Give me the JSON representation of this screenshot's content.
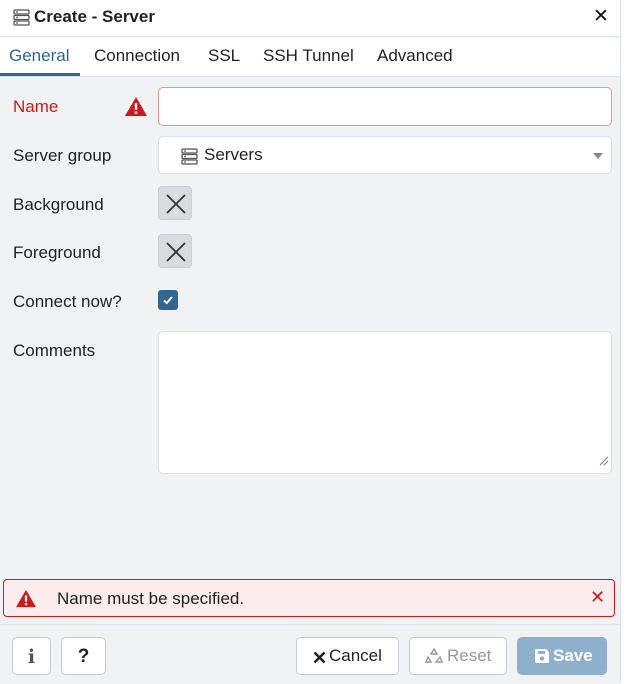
{
  "dialog": {
    "title": "Create - Server",
    "title_icon": "server-icon",
    "close_icon": "close-icon"
  },
  "tabs": [
    {
      "label": "General",
      "active": true
    },
    {
      "label": "Connection",
      "active": false
    },
    {
      "label": "SSL",
      "active": false
    },
    {
      "label": "SSH Tunnel",
      "active": false
    },
    {
      "label": "Advanced",
      "active": false
    }
  ],
  "form": {
    "name": {
      "label": "Name",
      "value": "",
      "status": "error",
      "status_icon": "warning-icon"
    },
    "server_group": {
      "label": "Server group",
      "value": "Servers",
      "icon": "server-icon"
    },
    "background": {
      "label": "Background",
      "value_icon": "no-color-x-icon"
    },
    "foreground": {
      "label": "Foreground",
      "value_icon": "no-color-x-icon"
    },
    "connect_now": {
      "label": "Connect now?",
      "checked": true
    },
    "comments": {
      "label": "Comments",
      "value": ""
    }
  },
  "error_banner": {
    "message": "Name must be specified.",
    "icon": "warning-icon"
  },
  "footer": {
    "info_label": "i",
    "help_label": "?",
    "cancel_label": "Cancel",
    "reset_label": "Reset",
    "save_label": "Save"
  },
  "colors": {
    "accent": "#326690",
    "error": "#ce1a1a",
    "panel_bg": "#f0f2f4",
    "save_disabled": "#8fb0ca"
  }
}
